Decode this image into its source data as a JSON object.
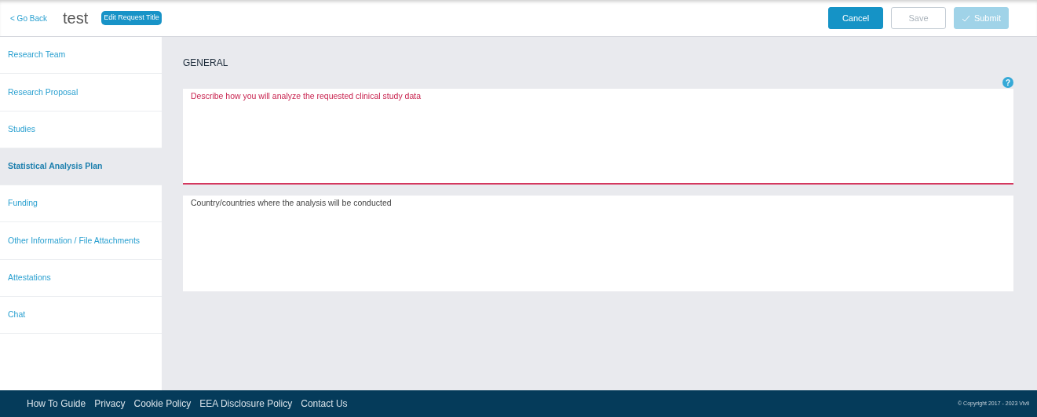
{
  "header": {
    "back_link": "< Go Back",
    "title": "test",
    "edit_button": "Edit Request Title",
    "buttons": [
      {
        "label": "Cancel",
        "kind": "primary",
        "disabled": false
      },
      {
        "label": "Save",
        "kind": "outline",
        "disabled": true
      },
      {
        "label": "Submit",
        "kind": "submit",
        "disabled": true
      }
    ]
  },
  "sidebar": {
    "items": [
      {
        "label": "Research Team",
        "selected": false
      },
      {
        "label": "Research Proposal",
        "selected": false
      },
      {
        "label": "Studies",
        "selected": false
      },
      {
        "label": "Statistical Analysis Plan",
        "selected": true
      },
      {
        "label": "Funding",
        "selected": false
      },
      {
        "label": "Other Information / File Attachments",
        "selected": false
      },
      {
        "label": "Attestations",
        "selected": false
      },
      {
        "label": "Chat",
        "selected": false
      }
    ]
  },
  "main": {
    "section_title": "GENERAL",
    "help": "?",
    "fields": [
      {
        "placeholder": "Describe how you will analyze the requested clinical study data",
        "invalid": true
      },
      {
        "placeholder": "Country/countries where the analysis will be conducted",
        "invalid": false
      }
    ]
  },
  "footer": {
    "links": [
      "How To Guide",
      "Privacy",
      "Cookie Policy",
      "EEA Disclosure Policy",
      "Contact Us"
    ],
    "copyright": "© Copyright 2017 - 2023 Vivli"
  }
}
